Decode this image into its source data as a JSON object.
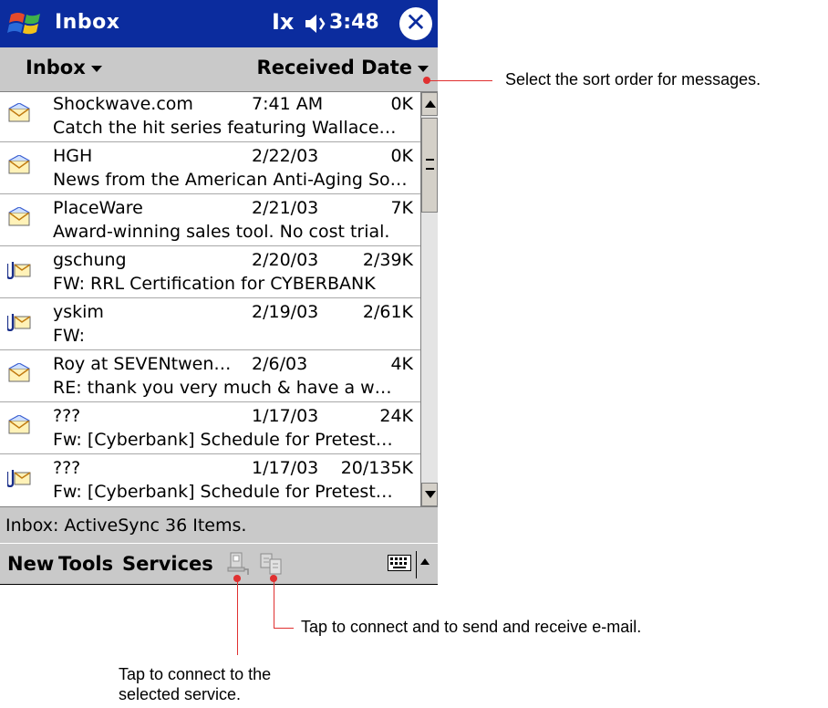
{
  "titlebar": {
    "title": "Inbox",
    "clock": "3:48",
    "close_label": "✕",
    "signal_glyph": "Ix",
    "speaker_glyph": "◀"
  },
  "header": {
    "folder_label": "Inbox",
    "sort_label": "Received Date"
  },
  "messages": [
    {
      "icon": "envelope-icon",
      "sender": "Shockwave.com",
      "date": "7:41 AM",
      "size": "0K",
      "subject": "Catch the hit series featuring Wallace…"
    },
    {
      "icon": "envelope-icon",
      "sender": "HGH",
      "date": "2/22/03",
      "size": "0K",
      "subject": "News from the American Anti-Aging So…"
    },
    {
      "icon": "envelope-icon",
      "sender": "PlaceWare",
      "date": "2/21/03",
      "size": "7K",
      "subject": "Award-winning sales tool. No cost trial."
    },
    {
      "icon": "attachment-envelope-icon",
      "sender": "gschung",
      "date": "2/20/03",
      "size": "2/39K",
      "subject": "FW: RRL Certification for CYBERBANK"
    },
    {
      "icon": "attachment-envelope-icon",
      "sender": "yskim",
      "date": "2/19/03",
      "size": "2/61K",
      "subject": "FW:"
    },
    {
      "icon": "envelope-icon",
      "sender": "Roy at SEVENtwen…",
      "date": "2/6/03",
      "size": "4K",
      "subject": "RE: thank you very much & have a w…"
    },
    {
      "icon": "envelope-icon",
      "sender": "???",
      "date": "1/17/03",
      "size": "24K",
      "subject": "Fw: [Cyberbank] Schedule for Pretest…"
    },
    {
      "icon": "attachment-envelope-icon",
      "sender": "???",
      "date": "1/17/03",
      "size": "20/135K",
      "subject": "Fw: [Cyberbank] Schedule for Pretest…"
    }
  ],
  "status": {
    "text": "Inbox: ActiveSync  36 Items."
  },
  "cmdbar": {
    "menu_new": "New",
    "menu_tools": "Tools",
    "menu_services": "Services"
  },
  "callouts": {
    "sort": "Select the sort order for messages.",
    "send_receive": "Tap to connect and to send and receive e-mail.",
    "connect": "Tap to connect to the selected service."
  },
  "colors": {
    "titlebar": "#0b2c9e",
    "bars": "#c9c9c9",
    "callout_line": "#e03030"
  }
}
